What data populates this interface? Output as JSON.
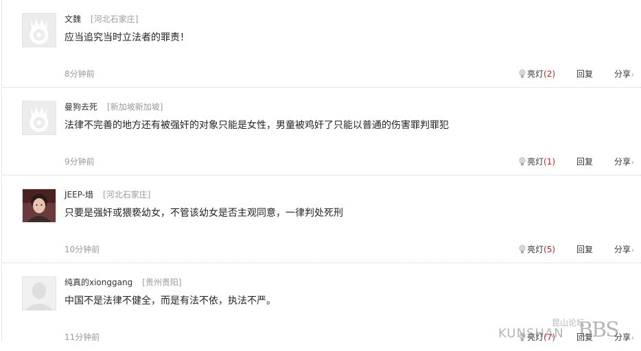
{
  "comments": [
    {
      "name": "文魏",
      "location": "[河北石家庄]",
      "text": "应当追究当时立法者的罪责！",
      "time": "8分钟前",
      "like_label": "亮灯",
      "like_count": "(2)",
      "reply_label": "回复",
      "share_label": "分享",
      "avatar": "default-avatar"
    },
    {
      "name": "曼狗去死",
      "location": "[新加坡新加坡]",
      "text": "法律不完善的地方还有被强奸的对象只能是女性，男童被鸡奸了只能以普通的伤害罪判罪犯",
      "time": "9分钟前",
      "like_label": "亮灯",
      "like_count": "(1)",
      "reply_label": "回复",
      "share_label": "分享",
      "avatar": "default-avatar"
    },
    {
      "name": "JEEP-焟",
      "location": "[河北石家庄]",
      "text": "只要是强奸或猥亵幼女，不管该幼女是否主观同意，一律判处死刑",
      "time": "10分钟前",
      "like_label": "亮灯",
      "like_count": "(5)",
      "reply_label": "回复",
      "share_label": "分享",
      "avatar": "photo-avatar"
    },
    {
      "name": "纯真的xionggang",
      "location": "[贵州贵阳]",
      "text": "中国不是法律不健全，而是有法不依，执法不严。",
      "time": "11分钟前",
      "like_label": "亮灯",
      "like_count": "(7)",
      "reply_label": "回复",
      "share_label": "分享",
      "avatar": "silhouette-avatar"
    }
  ],
  "watermark": {
    "chinese": "昆山论坛",
    "english": "KUNSHAN",
    "suffix": "BBS"
  },
  "colors": {
    "like_count": "#b22222",
    "muted_text": "#999999",
    "separator": "#cfcfcf"
  }
}
